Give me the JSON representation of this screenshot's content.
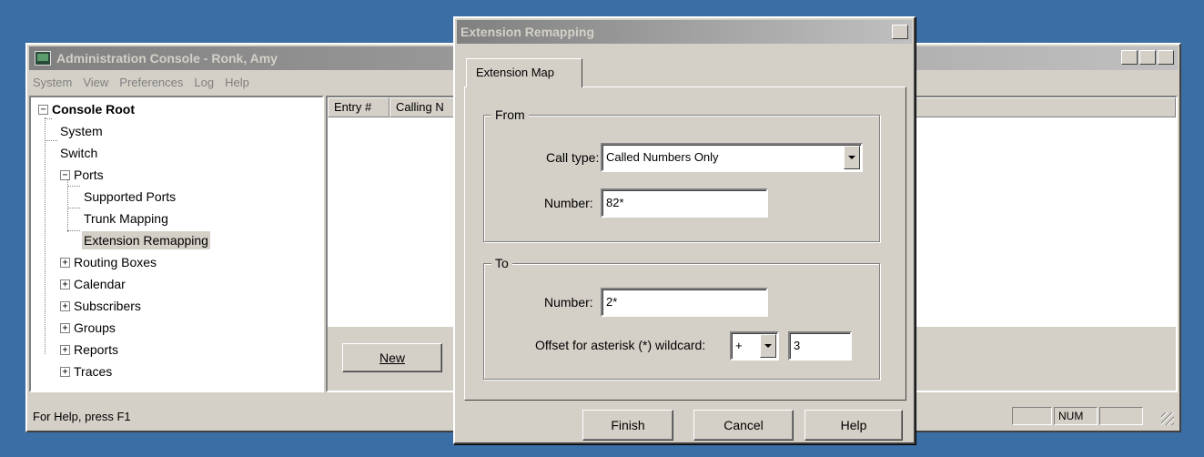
{
  "main_window": {
    "title": "Administration Console - Ronk, Amy",
    "controls": [
      "_",
      "□",
      "×"
    ],
    "menu": [
      "System",
      "View",
      "Preferences",
      "Log",
      "Help"
    ],
    "tree": {
      "root": "Console Root",
      "items": [
        "System",
        "Switch",
        "Ports",
        "Supported Ports",
        "Trunk Mapping",
        "Extension Remapping",
        "Routing Boxes",
        "Calendar",
        "Subscribers",
        "Groups",
        "Reports",
        "Traces"
      ],
      "selected": "Extension Remapping"
    },
    "list_headers": [
      "Entry #",
      "Calling N"
    ],
    "new_button": "New",
    "status_text": "For Help, press F1",
    "status_panels": [
      "",
      "NUM",
      ""
    ]
  },
  "dialog": {
    "title": "Extension Remapping",
    "close": "×",
    "tab": "Extension Map",
    "from": {
      "legend": "From",
      "call_type_label": "Call type:",
      "call_type_value": "Called Numbers Only",
      "number_label": "Number:",
      "number_value": "82*"
    },
    "to": {
      "legend": "To",
      "number_label": "Number:",
      "number_value": "2*",
      "offset_label": "Offset for asterisk (*) wildcard:",
      "offset_sign": "+",
      "offset_value": "3"
    },
    "buttons": {
      "finish": "Finish",
      "cancel": "Cancel",
      "help": "Help"
    }
  }
}
